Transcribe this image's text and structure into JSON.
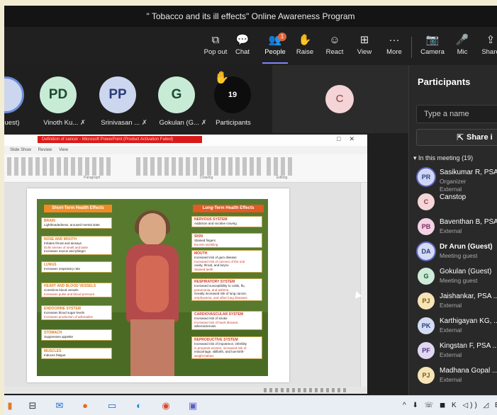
{
  "window": {
    "title": "\" Tobacco and its ill effects\" Online Awareness Program"
  },
  "toolbar": {
    "popout": {
      "label": "Pop out",
      "icon": "popout-icon"
    },
    "chat": {
      "label": "Chat",
      "icon": "chat-icon"
    },
    "people": {
      "label": "People",
      "icon": "people-icon",
      "badge": "1"
    },
    "raise": {
      "label": "Raise",
      "icon": "hand-icon"
    },
    "react": {
      "label": "React",
      "icon": "smiley-icon"
    },
    "view": {
      "label": "View",
      "icon": "grid-icon"
    },
    "more": {
      "label": "More",
      "icon": "ellipsis-icon"
    },
    "camera": {
      "label": "Camera",
      "icon": "camera-off-icon"
    },
    "mic": {
      "label": "Mic",
      "icon": "mic-off-icon"
    },
    "share": {
      "label": "Share",
      "icon": "share-icon"
    }
  },
  "strip": {
    "tiles": [
      {
        "initials": "",
        "name": "uest)"
      },
      {
        "initials": "PD",
        "name": "Vinoth Ku..."
      },
      {
        "initials": "PP",
        "name": "Srinivasan ..."
      },
      {
        "initials": "G",
        "name": "Gokulan (G..."
      }
    ],
    "more": {
      "count": "19",
      "label": "Participants"
    },
    "c_tile": {
      "initials": "C"
    }
  },
  "ppt": {
    "window_title": "Definition of cancer - Microsoft PowerPoint (Product Activation Failed)",
    "tabs": [
      "Slide Show",
      "Review",
      "View"
    ],
    "groups": [
      "Paragraph",
      "Drawing",
      "Editing"
    ],
    "poster": {
      "left_header": "Short-Term Health Effects",
      "right_header": "Long-Term Health Effects",
      "left_boxes": [
        {
          "title": "BRAIN",
          "lines": [
            "Lightheadedness, aroused mental state"
          ]
        },
        {
          "title": "NOSE AND MOUTH",
          "lines": [
            "Irritates throat and airways",
            "Dulls senses of smell and taste",
            "Increases mucus and phlegm"
          ]
        },
        {
          "title": "LUNGS",
          "lines": [
            "Increases respiratory rate"
          ]
        },
        {
          "title": "HEART AND BLOOD VESSELS",
          "lines": [
            "Constricts blood vessels",
            "Increases pulse and blood pressure"
          ]
        },
        {
          "title": "ENDOCRINE SYSTEM",
          "lines": [
            "Increases blood sugar levels",
            "Increases production of adrenaline"
          ]
        },
        {
          "title": "STOMACH",
          "lines": [
            "Suppresses appetite"
          ]
        },
        {
          "title": "MUSCLES",
          "lines": [
            "Induces fatigue"
          ]
        }
      ],
      "right_boxes": [
        {
          "title": "NERVOUS SYSTEM",
          "lines": [
            "Addiction and nicotine craving"
          ]
        },
        {
          "title": "SKIN",
          "lines": [
            "Stained fingers",
            "Excess wrinkling"
          ]
        },
        {
          "title": "MOUTH",
          "lines": [
            "Increased risk of gum disease",
            "Increased risk of cancers of the oral",
            "cavity, throat, and larynx",
            "Stained teeth"
          ]
        },
        {
          "title": "RESPIRATORY SYSTEM",
          "lines": [
            "Increased susceptibility to colds, flu,",
            "pneumonia, and asthma",
            "Greatly increased risk of lung cancer,",
            "emphysema, and other lung diseases"
          ]
        },
        {
          "title": "CARDIOVASCULAR SYSTEM",
          "lines": [
            "Increased risk of stroke",
            "Increased risk of heart disease,",
            "atherosclerosis"
          ]
        },
        {
          "title": "REPRODUCTIVE SYSTEM",
          "lines": [
            "Increased risk of impotence, infertility",
            "in pregnant women, increased risk of",
            "miscarriage, stillbirth, and low-birth-",
            "weight babies"
          ]
        }
      ]
    }
  },
  "panel": {
    "title": "Participants",
    "search_placeholder": "Type a name",
    "share_label": "Share i",
    "section": "In this meeting (19)",
    "participants": [
      {
        "initials": "PR",
        "name": "Sasikumar R, PSA C",
        "sub": "Organizer",
        "sub2": "External",
        "bg": "#cfd6f2",
        "fg": "#2b3f86",
        "ring": true,
        "bold": false
      },
      {
        "initials": "C",
        "name": "Canstop",
        "sub": "",
        "sub2": "",
        "bg": "#f5d5d7",
        "fg": "#8c3a41",
        "ring": false,
        "bold": false
      },
      {
        "initials": "PB",
        "name": "Baventhan B, PSA C",
        "sub": "External",
        "sub2": "",
        "bg": "#f3d2e6",
        "fg": "#7a2c5a",
        "ring": false,
        "bold": false
      },
      {
        "initials": "DA",
        "name": "Dr Arun (Guest)",
        "sub": "Meeting guest",
        "sub2": "",
        "bg": "#d4dbf3",
        "fg": "#2a3d80",
        "ring": true,
        "bold": true
      },
      {
        "initials": "G",
        "name": "Gokulan (Guest)",
        "sub": "Meeting guest",
        "sub2": "",
        "bg": "#cdebd8",
        "fg": "#1f5236",
        "ring": false,
        "bold": false
      },
      {
        "initials": "PJ",
        "name": "Jaishankar, PSA ...",
        "sub": "External",
        "sub2": "",
        "bg": "#f7e3b6",
        "fg": "#7a5a10",
        "ring": false,
        "bold": false
      },
      {
        "initials": "PK",
        "name": "Karthigayan KG, ...",
        "sub": "External",
        "sub2": "",
        "bg": "#d3dcf3",
        "fg": "#2a3e7e",
        "ring": false,
        "bold": false
      },
      {
        "initials": "PF",
        "name": "Kingstan F, PSA ...",
        "sub": "External",
        "sub2": "",
        "bg": "#e2d7f2",
        "fg": "#4f3381",
        "ring": false,
        "bold": false
      },
      {
        "initials": "PJ",
        "name": "Madhana Gopal ...",
        "sub": "External",
        "sub2": "",
        "bg": "#f6e4b9",
        "fg": "#7a5a10",
        "ring": false,
        "bold": false
      }
    ]
  },
  "taskbar": {
    "apps": [
      "file-explorer-icon",
      "taskview-icon",
      "mail-icon",
      "firefox-icon",
      "files-icon",
      "edge-icon",
      "chrome-icon",
      "teams-icon"
    ],
    "tray": "^ ⬇ ☏ ◼ K ◁)) ◿ EN"
  }
}
